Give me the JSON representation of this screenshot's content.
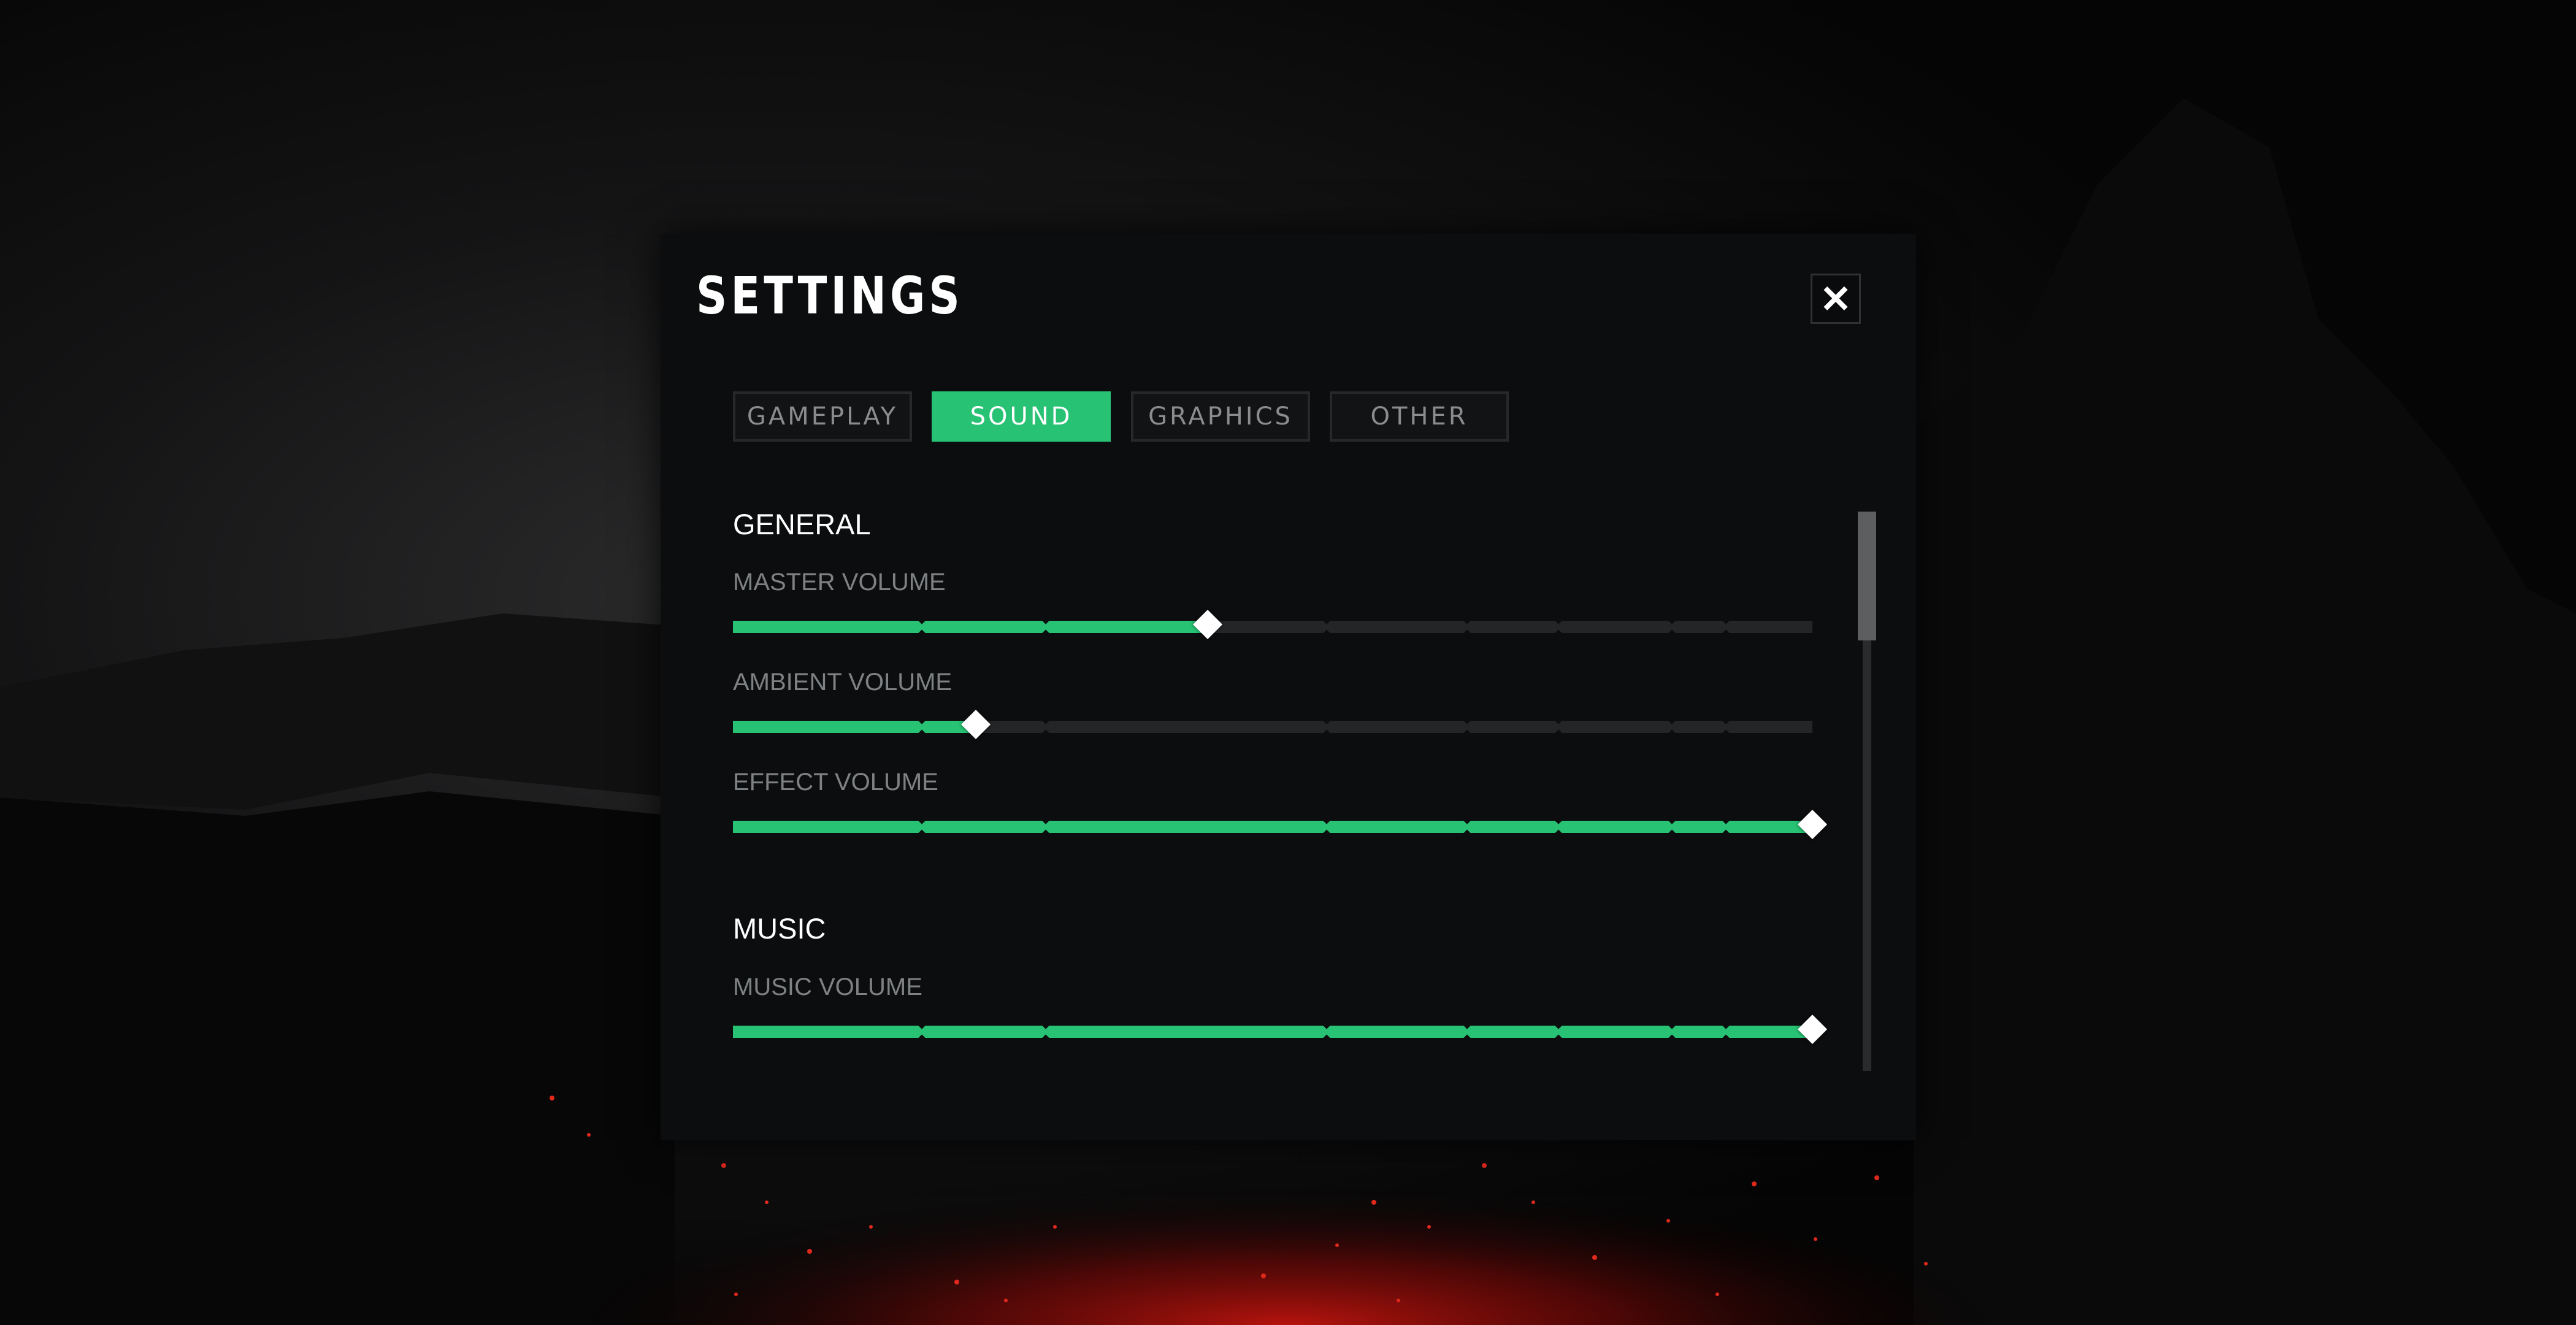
{
  "dialog": {
    "title": "SETTINGS",
    "close_label": "✕"
  },
  "tabs": [
    {
      "label": "GAMEPLAY",
      "active": false
    },
    {
      "label": "SOUND",
      "active": true
    },
    {
      "label": "GRAPHICS",
      "active": false
    },
    {
      "label": "OTHER",
      "active": false
    }
  ],
  "sections": {
    "general": {
      "title": "GENERAL",
      "sliders": [
        {
          "label": "MASTER VOLUME",
          "value": 0.44
        },
        {
          "label": "AMBIENT VOLUME",
          "value": 0.225
        },
        {
          "label": "EFFECT VOLUME",
          "value": 1.0
        }
      ]
    },
    "music": {
      "title": "MUSIC",
      "sliders": [
        {
          "label": "MUSIC VOLUME",
          "value": 1.0
        }
      ]
    }
  },
  "scroll": {
    "position": 0.0
  },
  "colors": {
    "accent": "#27c274",
    "panel": "#0c0d0e",
    "track": "#242526",
    "ember": "#c0140e"
  }
}
